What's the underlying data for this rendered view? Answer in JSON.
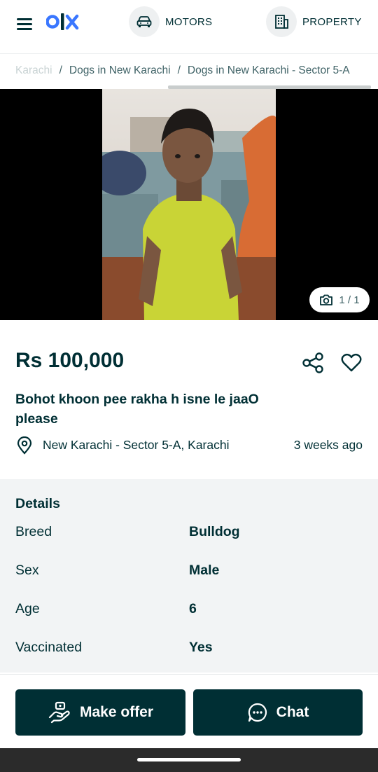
{
  "header": {
    "logo": "olx",
    "categories": [
      {
        "label": "MOTORS",
        "icon": "car-icon"
      },
      {
        "label": "PROPERTY",
        "icon": "building-icon"
      }
    ]
  },
  "breadcrumb": {
    "items": [
      "Karachi",
      "Dogs in New Karachi",
      "Dogs in New Karachi - Sector 5-A"
    ],
    "separator": "/"
  },
  "gallery": {
    "counter": "1 / 1"
  },
  "listing": {
    "price": "Rs 100,000",
    "title": "Bohot khoon pee rakha h isne le jaaO please",
    "location": "New Karachi - Sector 5-A, Karachi",
    "posted": "3 weeks ago"
  },
  "details": {
    "title": "Details",
    "rows": [
      {
        "key": "Breed",
        "value": "Bulldog"
      },
      {
        "key": "Sex",
        "value": "Male"
      },
      {
        "key": "Age",
        "value": "6"
      },
      {
        "key": "Vaccinated",
        "value": "Yes"
      }
    ]
  },
  "actions": {
    "offer_label": "Make offer",
    "chat_label": "Chat"
  },
  "colors": {
    "brand": "#002f34",
    "gallery_bg": "#000000",
    "details_bg": "#f2f4f5"
  }
}
